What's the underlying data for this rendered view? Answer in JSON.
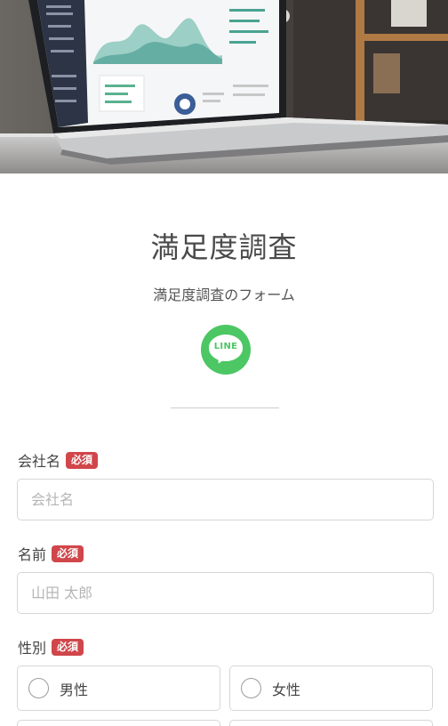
{
  "form": {
    "title": "満足度調査",
    "subtitle": "満足度調査のフォーム",
    "line_badge_text": "LINE",
    "required_label": "必須"
  },
  "fields": {
    "company": {
      "label": "会社名",
      "placeholder": "会社名"
    },
    "name": {
      "label": "名前",
      "placeholder": "山田 太郎"
    },
    "gender": {
      "label": "性別",
      "options": [
        "男性",
        "女性"
      ]
    }
  },
  "colors": {
    "line_green": "#4cc764",
    "required_badge": "#d0464a",
    "input_border": "#d6d6d6"
  }
}
